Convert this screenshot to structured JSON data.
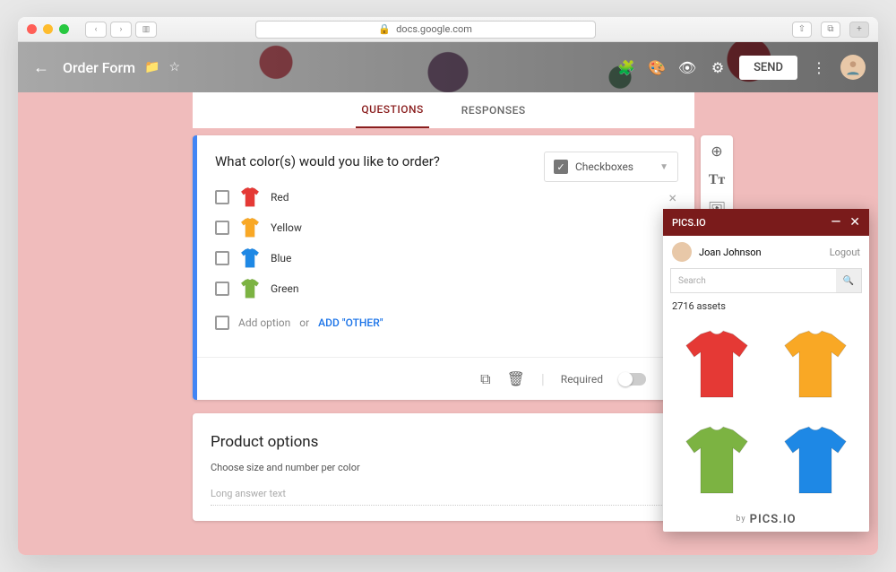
{
  "browser": {
    "url": "docs.google.com"
  },
  "header": {
    "title": "Order Form",
    "send": "SEND"
  },
  "tabs": {
    "questions": "QUESTIONS",
    "responses": "RESPONSES"
  },
  "question": {
    "title": "What color(s) would you like to order?",
    "type": "Checkboxes",
    "options": [
      {
        "label": "Red",
        "color": "#e53935"
      },
      {
        "label": "Yellow",
        "color": "#f9a825"
      },
      {
        "label": "Blue",
        "color": "#1e88e5"
      },
      {
        "label": "Green",
        "color": "#7cb342"
      }
    ],
    "add_option": "Add option",
    "or": "or",
    "add_other": "ADD \"OTHER\"",
    "required": "Required"
  },
  "section2": {
    "title": "Product options",
    "desc": "Choose size and number per color",
    "placeholder": "Long answer text"
  },
  "panel": {
    "brand": "PICS.IO",
    "user": "Joan Johnson",
    "logout": "Logout",
    "search_placeholder": "Search",
    "assets": "2716 assets",
    "thumbs": [
      "#e53935",
      "#f9a825",
      "#7cb342",
      "#1e88e5"
    ],
    "footer_prefix": "by",
    "footer_brand": "PICS.IO"
  }
}
